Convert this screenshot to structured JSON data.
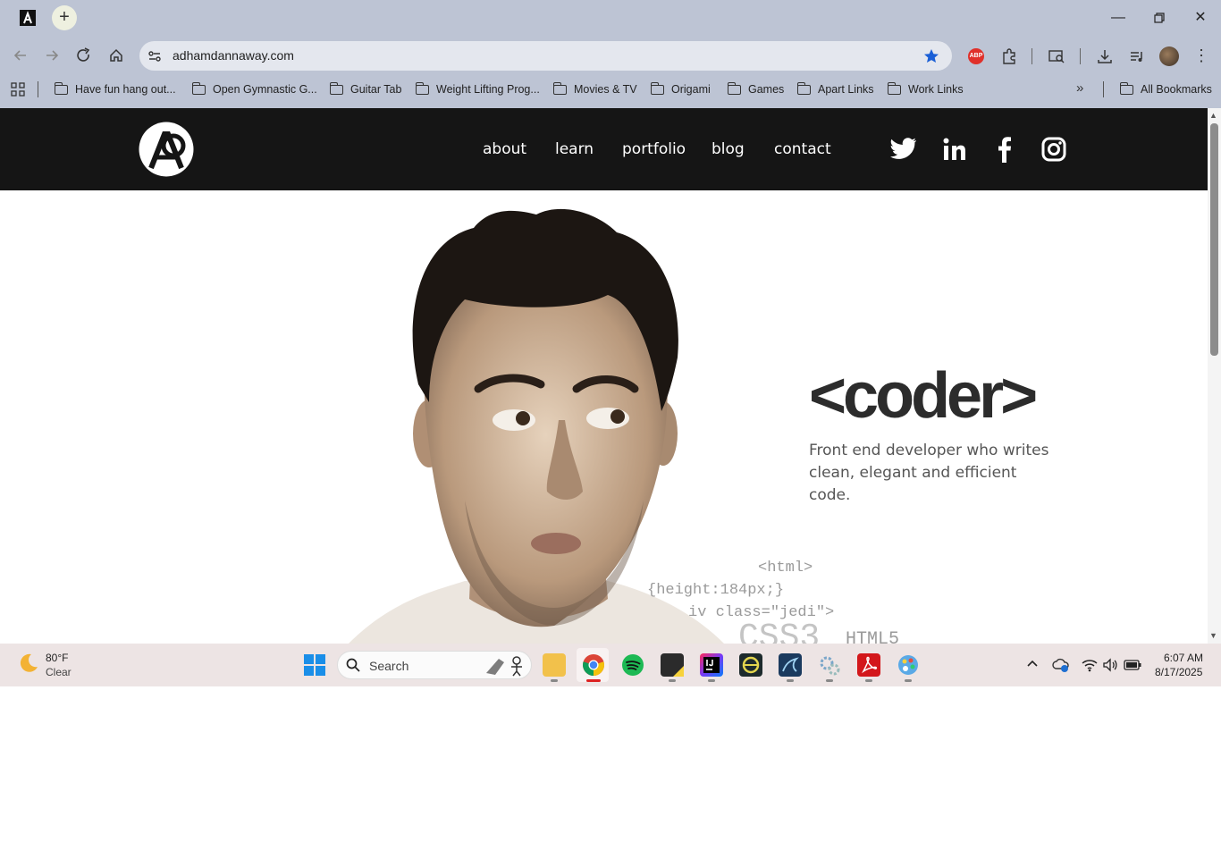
{
  "browser": {
    "url": "adhamdannaway.com",
    "bookmarks": [
      "Have fun hang out...",
      "Open Gymnastic G...",
      "Guitar Tab",
      "Weight Lifting Prog...",
      "Movies & TV",
      "Origami",
      "Games",
      "Apart Links",
      "Work Links"
    ],
    "all_bookmarks": "All Bookmarks",
    "extension_badge": "ABP"
  },
  "site": {
    "nav": [
      "about",
      "learn",
      "portfolio",
      "blog",
      "contact"
    ],
    "social": [
      "twitter-icon",
      "linkedin-icon",
      "facebook-icon",
      "instagram-icon"
    ],
    "hero_title": "<coder>",
    "hero_subtitle": "Front end developer who writes clean, elegant and efficient code.",
    "code_lines": [
      "<html>",
      "{height:184px;}",
      "iv class=\"jedi\">",
      "CSS3",
      "HTML5"
    ]
  },
  "taskbar": {
    "weather_temp": "80°F",
    "weather_desc": "Clear",
    "search_placeholder": "Search",
    "time": "6:07 AM",
    "date": "8/17/2025"
  },
  "colors": {
    "chrome_frame": "#bdc4d4",
    "site_header": "#151515",
    "hero_text": "#2c2c2c",
    "taskbar": "#ede4e4"
  }
}
